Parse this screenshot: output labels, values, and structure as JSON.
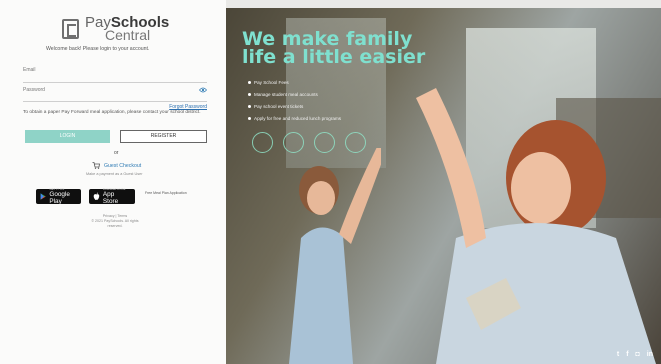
{
  "brand": {
    "pay": "Pay",
    "schools": "Schools",
    "central": "Central"
  },
  "login": {
    "welcome": "Welcome back! Please login to your account.",
    "email_label": "Email",
    "email_placeholder": "",
    "password_label": "Password",
    "password_placeholder": "",
    "forgot": "Forgot Password",
    "help_text": "To obtain a paper Pay Forward meal application, please contact your school district.",
    "login_button": "LOGIN",
    "register_button": "REGISTER",
    "or": "or",
    "guest_checkout": "Guest Checkout",
    "guest_sub": "Make a payment as a Guest User",
    "google_play_small": "GET IT ON",
    "google_play": "Google Play",
    "app_store_small": "Download on the",
    "app_store": "App Store",
    "sfp_text": "Free Meal Plan Application",
    "footer_line1": "Privacy | Terms",
    "footer_line2": "© 2021 PaySchools. All rights reserved."
  },
  "hero": {
    "title": "We make family life a little easier",
    "bullets": [
      "Pay School Fees",
      "Manage student meal accounts",
      "Pay school event tickets",
      "Apply for free and reduced lunch programs"
    ],
    "social": [
      "twitter-icon",
      "facebook-icon",
      "instagram-icon",
      "linkedin-icon"
    ]
  },
  "colors": {
    "accent": "#8fd3c7",
    "hero_title": "#7fe0cf",
    "link": "#2f7bb4"
  }
}
